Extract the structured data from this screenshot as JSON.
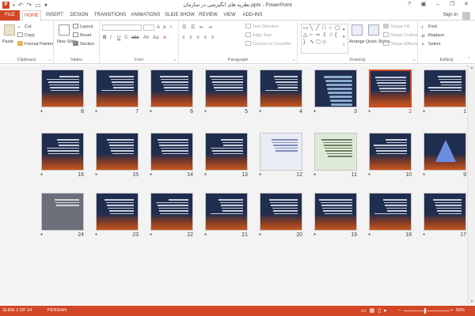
{
  "window": {
    "title": "نظریه های انگیزشی در سازمان.pptx - PowerPoint",
    "app_icon": "P",
    "qat": [
      "save-icon",
      "undo-icon",
      "redo-icon",
      "present-icon",
      "customize-icon"
    ],
    "controls": [
      "?",
      "▣",
      "–",
      "❐",
      "✕"
    ]
  },
  "tabs": [
    "FILE",
    "HOME",
    "INSERT",
    "DESIGN",
    "TRANSITIONS",
    "ANIMATIONS",
    "SLIDE SHOW",
    "REVIEW",
    "VIEW",
    "ADD-INS"
  ],
  "active_tab": "HOME",
  "signin": "Sign in",
  "ribbon": {
    "clipboard": {
      "label": "Clipboard",
      "paste": "Paste",
      "cut": "Cut",
      "copy": "Copy",
      "format_painter": "Format Painter"
    },
    "slides": {
      "label": "Slides",
      "new_slide": "New Slide",
      "layout": "Layout",
      "reset": "Reset",
      "section": "Section"
    },
    "font": {
      "label": "Font",
      "font_name": "",
      "font_size": "",
      "buttons": [
        "B",
        "I",
        "U",
        "S",
        "abc",
        "AV",
        "Aa",
        "A"
      ],
      "size_buttons": [
        "A",
        "A",
        "A"
      ]
    },
    "paragraph": {
      "label": "Paragraph",
      "text_direction": "Text Direction",
      "align_text": "Align Text",
      "convert": "Convert to SmartArt"
    },
    "drawing": {
      "label": "Drawing",
      "arrange": "Arrange",
      "quick_styles": "Quick Styles",
      "shape_fill": "Shape Fill",
      "shape_outline": "Shape Outline",
      "shape_effects": "Shape Effects"
    },
    "editing": {
      "label": "Editing",
      "find": "Find",
      "replace": "Replace",
      "select": "Select"
    }
  },
  "slides": {
    "rows": [
      [
        {
          "num": "8",
          "style": "dark"
        },
        {
          "num": "7",
          "style": "dark"
        },
        {
          "num": "6",
          "style": "dark"
        },
        {
          "num": "5",
          "style": "dark"
        },
        {
          "num": "4",
          "style": "dark"
        },
        {
          "num": "3",
          "style": "pattern"
        },
        {
          "num": "2",
          "style": "dark"
        },
        {
          "num": "1",
          "style": "dark"
        }
      ],
      [
        {
          "num": "16",
          "style": "dark"
        },
        {
          "num": "15",
          "style": "dark"
        },
        {
          "num": "14",
          "style": "dark"
        },
        {
          "num": "13",
          "style": "dark"
        },
        {
          "num": "12",
          "style": "table"
        },
        {
          "num": "11",
          "style": "light"
        },
        {
          "num": "10",
          "style": "dark"
        },
        {
          "num": "9",
          "style": "pyramid"
        }
      ],
      [
        {
          "num": "24",
          "style": "photo"
        },
        {
          "num": "23",
          "style": "dark"
        },
        {
          "num": "22",
          "style": "dark"
        },
        {
          "num": "21",
          "style": "dark"
        },
        {
          "num": "20",
          "style": "dark"
        },
        {
          "num": "19",
          "style": "dark"
        },
        {
          "num": "18",
          "style": "dark"
        },
        {
          "num": "17",
          "style": "dark"
        }
      ]
    ],
    "selected": "2",
    "star": "*"
  },
  "status": {
    "slide_info": "SLIDE 2 OF 24",
    "language": "PERSIAN",
    "zoom": "50%",
    "minus": "–",
    "plus": "+",
    "view_icons": [
      "normal-view-icon",
      "slide-sorter-icon",
      "reading-view-icon",
      "slideshow-icon"
    ]
  },
  "colors": {
    "accent": "#d24726",
    "slide_bg": "#1f2d4e"
  }
}
